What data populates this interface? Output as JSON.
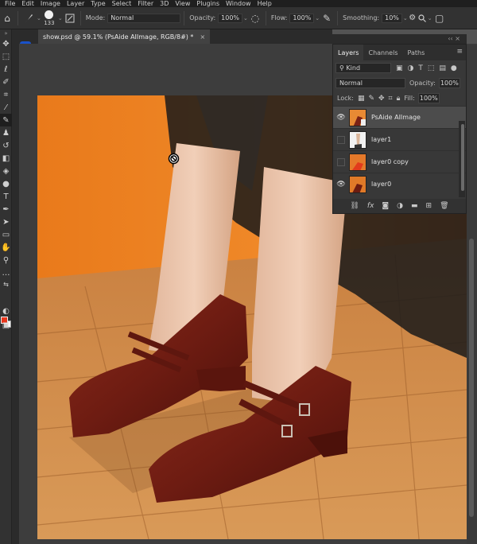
{
  "menubar": {
    "items": [
      "File",
      "Edit",
      "Image",
      "Layer",
      "Type",
      "Select",
      "Filter",
      "3D",
      "View",
      "Plugins",
      "Window",
      "Help"
    ]
  },
  "options": {
    "brush_size": "133",
    "mode_label": "Mode:",
    "mode_value": "Normal",
    "opacity_label": "Opacity:",
    "opacity_value": "100%",
    "flow_label": "Flow:",
    "flow_value": "100%",
    "smoothing_label": "Smoothing:",
    "smoothing_value": "10%"
  },
  "document": {
    "tab_title": "show.psd @ 59.1% (PsAide AIImage, RGB/8#) *",
    "close_glyph": "×",
    "app_badge": "AI"
  },
  "layers_panel": {
    "tabs": [
      "Layers",
      "Channels",
      "Paths"
    ],
    "kind_label": "Kind",
    "blend_mode": "Normal",
    "opacity_label": "Opacity:",
    "opacity_value": "100%",
    "lock_label": "Lock:",
    "fill_label": "Fill:",
    "fill_value": "100%",
    "layers": [
      {
        "name": "PsAide AIImage",
        "visible": true,
        "selected": true
      },
      {
        "name": "layer1",
        "visible": false,
        "selected": false
      },
      {
        "name": "layer0 copy",
        "visible": false,
        "selected": false
      },
      {
        "name": "layer0",
        "visible": true,
        "selected": false
      }
    ],
    "footer_icons": [
      "link-icon",
      "fx-icon",
      "mask-icon",
      "adjustment-icon",
      "folder-icon",
      "new-layer-icon",
      "trash-icon"
    ]
  },
  "colors": {
    "foreground": "#e8361c",
    "background": "#ffffff",
    "app_badge": "#1a52c9"
  }
}
